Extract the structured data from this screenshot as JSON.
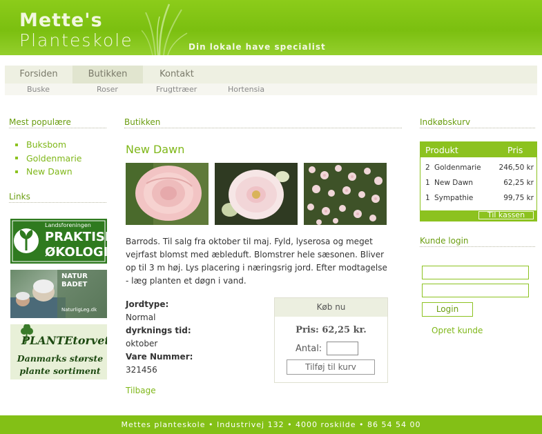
{
  "header": {
    "logo_line1": "Mette's",
    "logo_line2": "Planteskole",
    "tagline": "Din lokale have specialist"
  },
  "nav": {
    "items": [
      {
        "label": "Forsiden",
        "active": false
      },
      {
        "label": "Butikken",
        "active": true
      },
      {
        "label": "Kontakt",
        "active": false
      }
    ],
    "sub_items": [
      "Buske",
      "Roser",
      "Frugttræer",
      "Hortensia"
    ]
  },
  "left": {
    "popular_title": "Mest populære",
    "popular_items": [
      "Buksbom",
      "Goldenmarie",
      "New Dawn"
    ],
    "links_title": "Links",
    "ads": [
      {
        "name": "praktisk-okologi",
        "line1": "Landsforeningen",
        "line2": "PRAKTISK",
        "line3": "ØKOLOGI"
      },
      {
        "name": "natur-badet",
        "line1": "NATUR",
        "line2": "BADET",
        "line3": "NaturligLeg.dk"
      },
      {
        "name": "plantetorvet",
        "line1": "PLANTEtorvet",
        "line2": "Danmarks største",
        "line3": "plante sortiment"
      }
    ]
  },
  "main": {
    "section_title": "Butikken",
    "product_title": "New Dawn",
    "description": "Barrods. Til salg fra oktober til maj. Fyld, lyserosa og meget vejrfast blomst med æbleduft. Blomstrer hele sæsonen. Bliver op til 3 m høj. Lys placering i næringsrig jord. Efter modtagelse - læg planten et døgn i vand.",
    "specs": [
      {
        "label": "Jordtype:",
        "value": "Normal"
      },
      {
        "label": "dyrknings tid:",
        "value": "oktober"
      },
      {
        "label": "Vare Nummer:",
        "value": "321456"
      }
    ],
    "back_link": "Tilbage",
    "buy_box": {
      "title": "Køb nu",
      "price": "Pris: 62,25 kr.",
      "qty_label": "Antal:",
      "qty_value": "",
      "add_button": "Tilføj til kurv"
    }
  },
  "right": {
    "cart_title": "Indkøbskurv",
    "cart_headers": {
      "product": "Produkt",
      "price": "Pris"
    },
    "cart_rows": [
      {
        "qty": "2",
        "product": "Goldenmarie",
        "price": "246,50 kr"
      },
      {
        "qty": "1",
        "product": "New Dawn",
        "price": "62,25 kr"
      },
      {
        "qty": "1",
        "product": "Sympathie",
        "price": "99,75 kr"
      }
    ],
    "checkout_button": "Til kassen",
    "login_title": "Kunde login",
    "username_value": "",
    "password_value": "",
    "login_button": "Login",
    "create_link": "Opret kunde"
  },
  "footer": {
    "text": "Mettes planteskole • Industrivej 132 • 4000 roskilde • 86 54 54 00"
  },
  "colors": {
    "brand_green": "#8cc21f",
    "link_green": "#7fb719",
    "nav_bg": "#eef0e2"
  }
}
